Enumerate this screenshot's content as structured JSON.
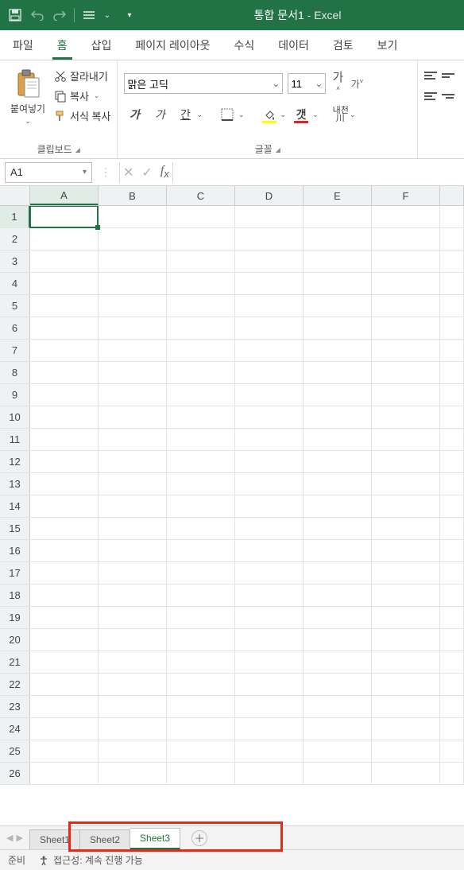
{
  "titlebar": {
    "workbook": "통합 문서1",
    "separator": " - ",
    "app": "Excel"
  },
  "ribbon_tabs": [
    "파일",
    "홈",
    "삽입",
    "페이지 레이아웃",
    "수식",
    "데이터",
    "검토",
    "보기"
  ],
  "active_tab_index": 1,
  "clipboard": {
    "paste_label": "붙여넣기",
    "cut_label": "잘라내기",
    "copy_label": "복사",
    "format_painter_label": "서식 복사",
    "group_label": "클립보드"
  },
  "font": {
    "font_name": "맑은 고딕",
    "font_size": "11",
    "grow_label": "가",
    "shrink_label": "가",
    "bold_label": "가",
    "italic_label": "가",
    "underline_label": "간",
    "fontcolor_label": "갯",
    "ruby_label": "내천",
    "ruby_sub": "川",
    "group_label": "글꼴"
  },
  "name_box": "A1",
  "columns": [
    "A",
    "B",
    "C",
    "D",
    "E",
    "F"
  ],
  "row_count": 26,
  "active_cell": {
    "row": 1,
    "col": 0
  },
  "sheets": [
    "Sheet1",
    "Sheet2",
    "Sheet3"
  ],
  "active_sheet_index": 2,
  "status": {
    "ready": "준비",
    "accessibility": "접근성: 계속 진행 가능"
  }
}
